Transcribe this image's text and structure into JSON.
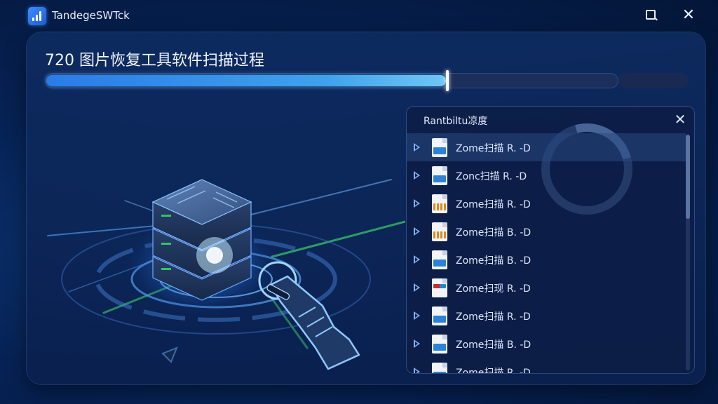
{
  "app": {
    "title": "TandegeSWTck"
  },
  "window": {
    "maximize_icon": "maximize-icon",
    "close_glyph": "✕"
  },
  "main": {
    "title": "720 图片恢复工具软件扫描过程",
    "progress": {
      "fraction": 0.7
    }
  },
  "panel": {
    "title": "Rantbiltu凉度",
    "close_glyph": "✕",
    "files": [
      {
        "name": "Zome扫描 R. -D",
        "icon": "blue"
      },
      {
        "name": "Zonc扫描 R. -D",
        "icon": "blue"
      },
      {
        "name": "Zome扫描 R. -D",
        "icon": "bars"
      },
      {
        "name": "Zome扫描 B. -D",
        "icon": "bars"
      },
      {
        "name": "Zome扫描 B. -D",
        "icon": "blue"
      },
      {
        "name": "Zome扫现 R. -D",
        "icon": "mixed"
      },
      {
        "name": "Zome扫描 R. -D",
        "icon": "blue"
      },
      {
        "name": "Zome扫描 B. -D",
        "icon": "blue"
      },
      {
        "name": "Zome扫描 R. -D",
        "icon": "blue"
      }
    ]
  },
  "colors": {
    "accent": "#3ea2ec",
    "background": "#062255"
  }
}
